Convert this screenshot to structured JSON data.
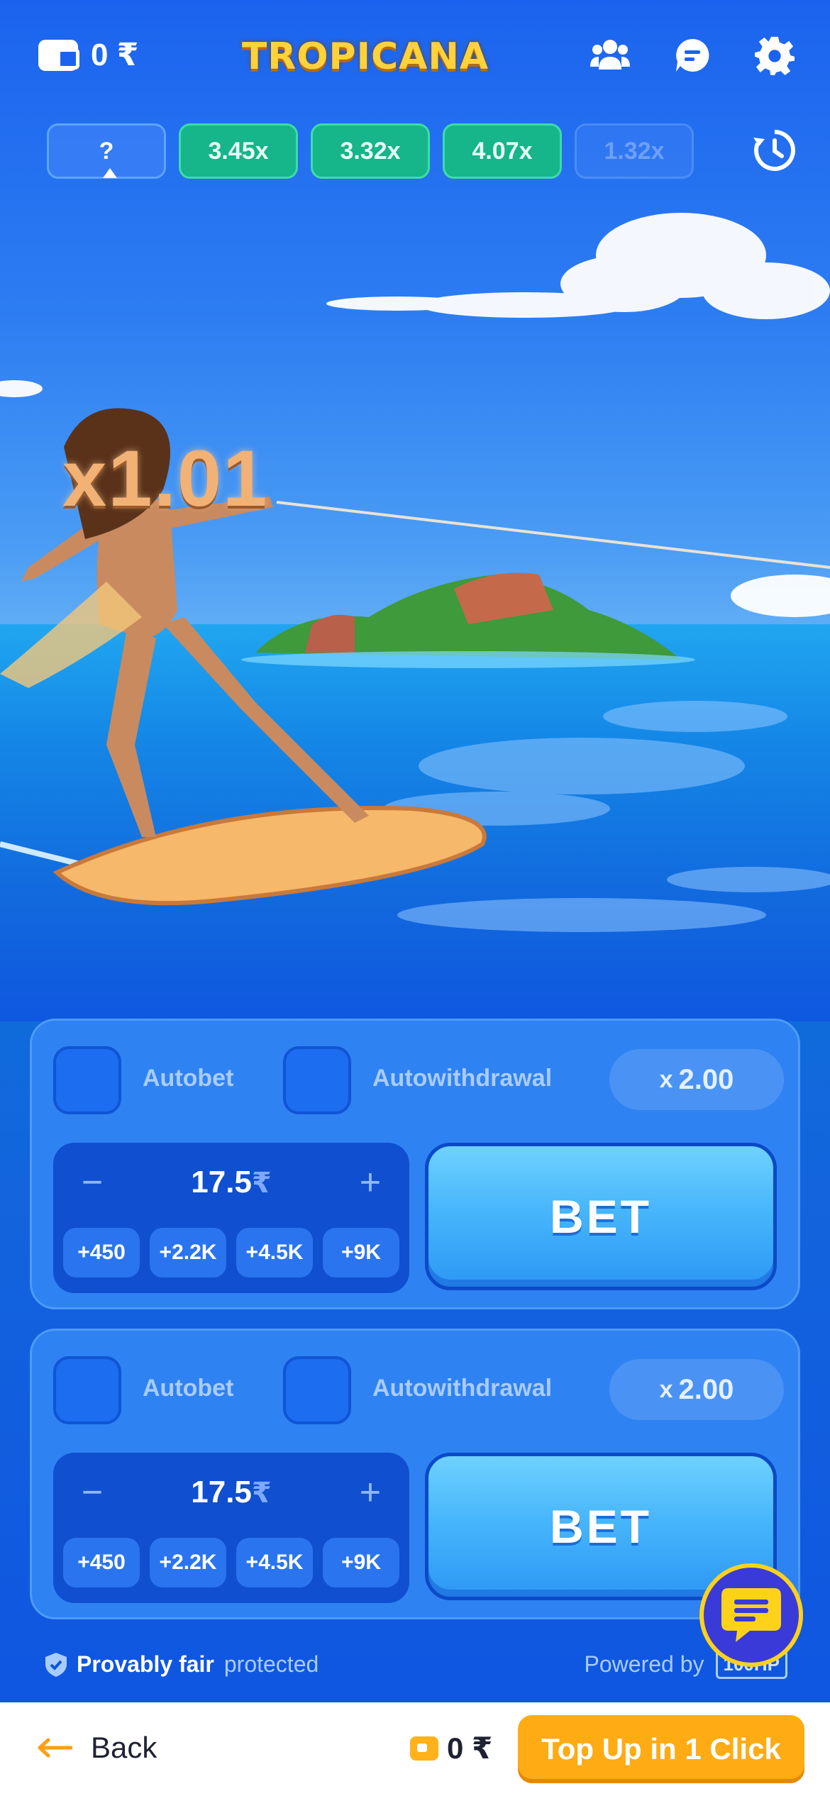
{
  "header": {
    "wallet_balance": "0 ₹",
    "logo_text": "TROPICANA"
  },
  "history": {
    "current": "?",
    "items": [
      "3.45x",
      "3.32x",
      "4.07x",
      "1.32x"
    ]
  },
  "game": {
    "multiplier": "x1.01"
  },
  "bets": [
    {
      "autobet_label": "Autobet",
      "autowithdrawal_label": "Autowithdrawal",
      "coef_prefix": "x",
      "coef_value": "2.00",
      "amount": "17.5",
      "currency": "₹",
      "minus": "−",
      "plus": "+",
      "quick": [
        "+450",
        "+2.2K",
        "+4.5K",
        "+9K"
      ],
      "bet_label": "BET"
    },
    {
      "autobet_label": "Autobet",
      "autowithdrawal_label": "Autowithdrawal",
      "coef_prefix": "x",
      "coef_value": "2.00",
      "amount": "17.5",
      "currency": "₹",
      "minus": "−",
      "plus": "+",
      "quick": [
        "+450",
        "+2.2K",
        "+4.5K",
        "+9K"
      ],
      "bet_label": "BET"
    }
  ],
  "footer": {
    "fair_bold": "Provably fair",
    "fair_muted": "protected",
    "powered_by": "Powered by",
    "provider_badge": "100HP"
  },
  "bottom_bar": {
    "back_label": "Back",
    "balance": "0 ₹",
    "topup_label": "Top Up in 1 Click"
  },
  "colors": {
    "accent_green": "#16b58a",
    "bet_button": "#47b6fb",
    "topup": "#ffab14"
  }
}
